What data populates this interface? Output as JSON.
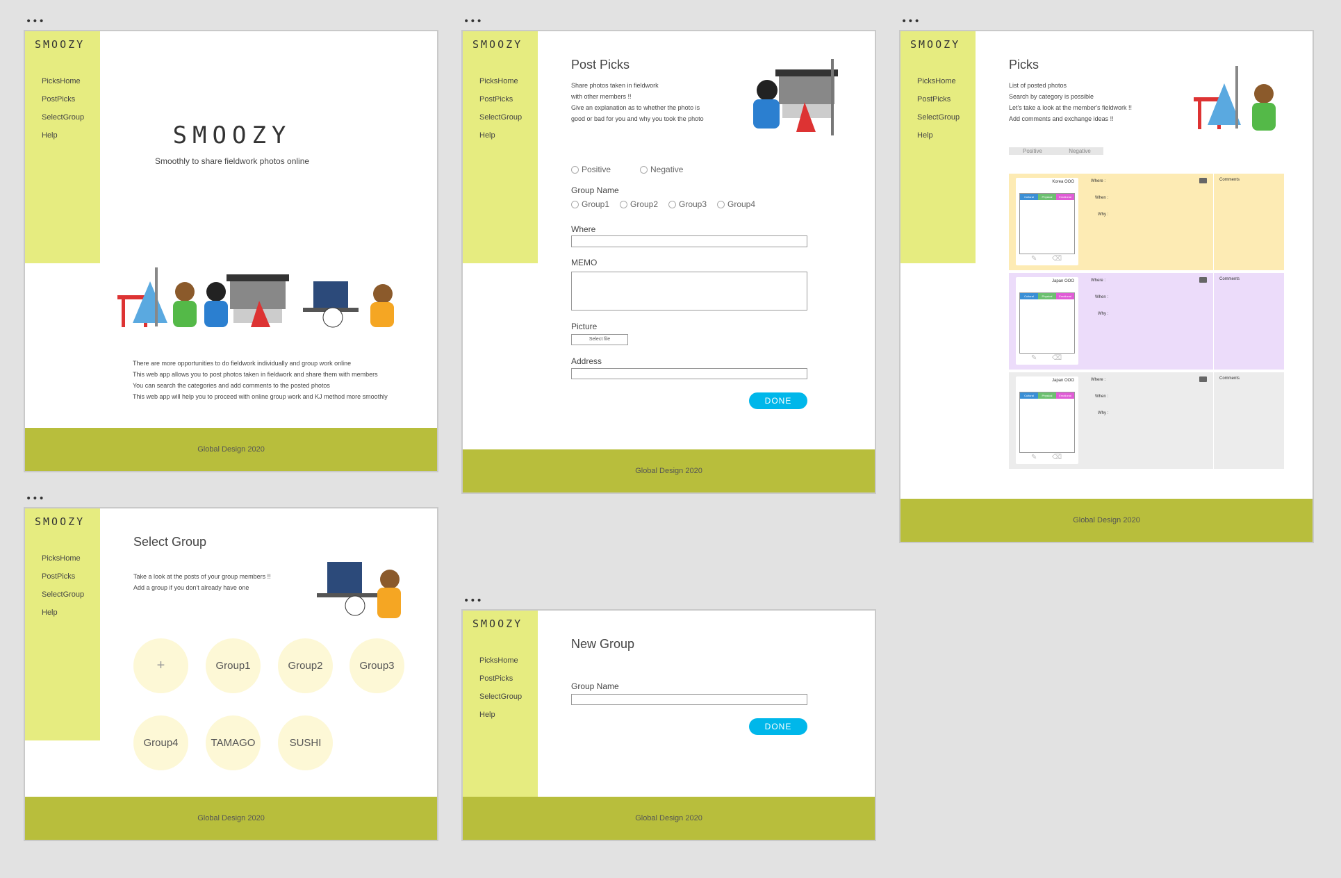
{
  "logo": "SMOOZY",
  "nav": [
    "PicksHome",
    "PostPicks",
    "SelectGroup",
    "Help"
  ],
  "footer": "Global Design 2020",
  "window_dots": "•••",
  "home": {
    "brand": "SMOOZY",
    "tagline": "Smoothly to share fieldwork photos online",
    "desc": [
      "There are more opportunities to do fieldwork individually and group work online",
      "This web app allows you to post photos taken in fieldwork and share them with members",
      "You can search the categories and add comments to the posted photos",
      "This web app will help you to proceed with online group work and KJ method more smoothly"
    ]
  },
  "post": {
    "title": "Post Picks",
    "desc": [
      "Share photos taken in fieldwork",
      "with other members !!",
      "Give an explanation as to whether the photo is",
      "good or bad for you and why you took the photo"
    ],
    "positive": "Positive",
    "negative": "Negative",
    "group_name_label": "Group Name",
    "groups": [
      "Group1",
      "Group2",
      "Group3",
      "Group4"
    ],
    "where_label": "Where",
    "memo_label": "MEMO",
    "picture_label": "Picture",
    "select_file": "Select file",
    "address_label": "Address",
    "done": "DONE"
  },
  "picks": {
    "title": "Picks",
    "desc": [
      "List of posted photos",
      "Search by category is possible",
      "Let's take a look at the member's fieldwork !!",
      "Add comments and exchange ideas !!"
    ],
    "filter_positive": "Positive",
    "filter_negative": "Negative",
    "tags": [
      "Cultural",
      "Physical",
      "Emotional"
    ],
    "tag_colors": [
      "#3a8fd6",
      "#6cc070",
      "#e05cd6"
    ],
    "where": "Where :",
    "when": "When :",
    "why": "Why :",
    "comments": "Comments",
    "cards": [
      {
        "country": "Korea OOO",
        "bg": "#fdebb4"
      },
      {
        "country": "Japan OOO",
        "bg": "#ecdcfa"
      },
      {
        "country": "Japan OOO",
        "bg": "#ececec"
      }
    ]
  },
  "select": {
    "title": "Select Group",
    "desc": [
      "Take a look at the posts of your group members !!",
      "Add a group if you don't already have one"
    ],
    "groups": [
      "+",
      "Group1",
      "Group2",
      "Group3",
      "Group4",
      "TAMAGO",
      "SUSHI"
    ]
  },
  "newgroup": {
    "title": "New Group",
    "group_name_label": "Group Name",
    "done": "DONE"
  }
}
